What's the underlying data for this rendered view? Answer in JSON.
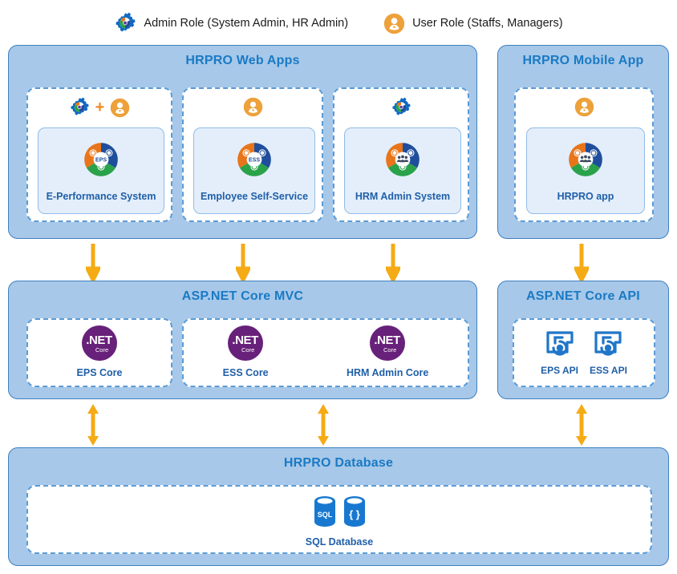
{
  "legend": {
    "items": [
      {
        "icon": "admin-gear-icon",
        "label": "Admin Role (System Admin, HR Admin)"
      },
      {
        "icon": "user-person-icon",
        "label": "User Role (Staffs, Managers)"
      }
    ]
  },
  "panels": {
    "web_apps": {
      "title": "HRPRO Web Apps",
      "cards": [
        {
          "roles": [
            "admin-gear-icon",
            "plus",
            "user-person-icon"
          ],
          "plus_symbol": "+",
          "logo": "eps-donut-icon",
          "logo_center_text": "EPS",
          "label": "E-Performance System"
        },
        {
          "roles": [
            "user-person-icon"
          ],
          "logo": "ess-donut-icon",
          "logo_center_text": "ESS",
          "label": "Employee Self-Service"
        },
        {
          "roles": [
            "admin-gear-icon"
          ],
          "logo": "hrm-donut-icon",
          "logo_center_text": "",
          "label": "HRM Admin System"
        }
      ]
    },
    "mobile_app": {
      "title": "HRPRO Mobile App",
      "cards": [
        {
          "roles": [
            "user-person-icon"
          ],
          "logo": "hrpro-donut-icon",
          "logo_center_text": "",
          "label": "HRPRO app"
        }
      ]
    },
    "mvc": {
      "title": "ASP.NET Core MVC",
      "groups": [
        {
          "items": [
            {
              "icon": "dotnet-core-icon",
              "line1": ".NET",
              "line2": "Core",
              "label": "EPS Core"
            }
          ]
        },
        {
          "items": [
            {
              "icon": "dotnet-core-icon",
              "line1": ".NET",
              "line2": "Core",
              "label": "ESS Core"
            },
            {
              "icon": "dotnet-core-icon",
              "line1": ".NET",
              "line2": "Core",
              "label": "HRM Admin Core"
            }
          ]
        }
      ]
    },
    "api": {
      "title": "ASP.NET Core API",
      "items": [
        {
          "icon": "api-endpoint-icon",
          "label": "EPS API"
        },
        {
          "icon": "api-endpoint-icon",
          "label": "ESS API"
        }
      ]
    },
    "database": {
      "title": "HRPRO Database",
      "item": {
        "icons": [
          "sql-cylinder-icon",
          "json-cylinder-icon"
        ],
        "sql_text": "SQL",
        "json_text": "{ }",
        "label": "SQL Database"
      }
    }
  },
  "colors": {
    "panel_fill": "#a7c8e9",
    "panel_border": "#3f7fbf",
    "title_text": "#1a7ac4",
    "label_text": "#1f5fa8",
    "arrow": "#f5ab15",
    "accent_orange": "#ef8a23",
    "dotnet_purple": "#68217a",
    "db_blue": "#1878d0",
    "inner_fill": "#e4eefa"
  },
  "arrows": [
    {
      "name": "arrow-eps-to-mvc",
      "direction": "down"
    },
    {
      "name": "arrow-ess-to-mvc",
      "direction": "down"
    },
    {
      "name": "arrow-hrm-to-mvc",
      "direction": "down"
    },
    {
      "name": "arrow-mobile-to-api",
      "direction": "down"
    },
    {
      "name": "arrow-mvc-to-db-left",
      "direction": "both"
    },
    {
      "name": "arrow-mvc-to-db-right",
      "direction": "both"
    },
    {
      "name": "arrow-api-to-db",
      "direction": "both"
    }
  ]
}
